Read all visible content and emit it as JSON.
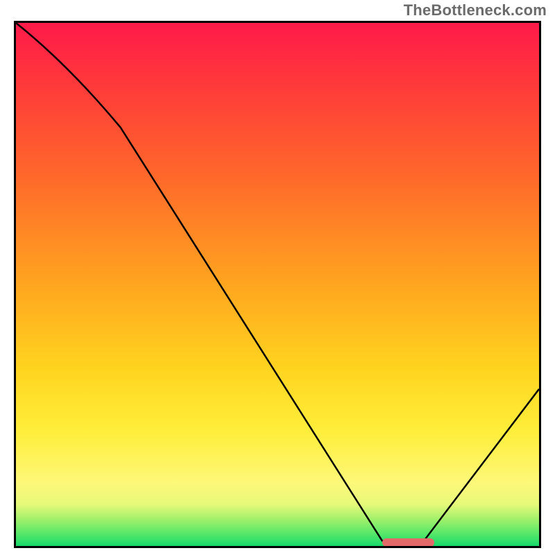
{
  "watermark": "TheBottleneck.com",
  "chart_data": {
    "type": "line",
    "title": "",
    "xlabel": "",
    "ylabel": "",
    "xlim": [
      0,
      100
    ],
    "ylim": [
      0,
      100
    ],
    "x": [
      0,
      20,
      70,
      78,
      100
    ],
    "values": [
      100,
      80,
      1,
      1,
      30
    ],
    "marker": {
      "x_start": 70,
      "x_end": 80,
      "y": 0.6
    },
    "gradient_stops": [
      {
        "pos": 0,
        "color": "#ff1a4a"
      },
      {
        "pos": 12,
        "color": "#ff3a3a"
      },
      {
        "pos": 30,
        "color": "#ff6a2a"
      },
      {
        "pos": 50,
        "color": "#ffa51f"
      },
      {
        "pos": 66,
        "color": "#ffd41f"
      },
      {
        "pos": 78,
        "color": "#ffee3a"
      },
      {
        "pos": 88,
        "color": "#fdf879"
      },
      {
        "pos": 92,
        "color": "#e7f97a"
      },
      {
        "pos": 95,
        "color": "#9ef06a"
      },
      {
        "pos": 98,
        "color": "#4de66a"
      },
      {
        "pos": 100,
        "color": "#17d86a"
      }
    ]
  }
}
